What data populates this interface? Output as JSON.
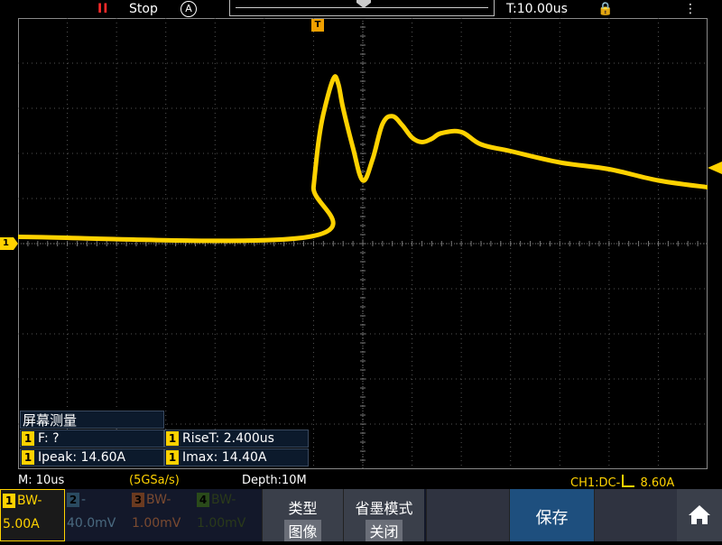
{
  "top_bar": {
    "run_icon": "II",
    "run_status": "Stop",
    "trigger_mode": "A",
    "trigger_delay": "T:10.00us",
    "lock_icon": "lock-icon",
    "usb_icon": "usb-icon"
  },
  "markers": {
    "trigger_flag": "T",
    "ch1_flag": "1"
  },
  "measurements": {
    "title": "屏幕测量",
    "items": [
      {
        "channel": "1",
        "text": "F:    ?"
      },
      {
        "channel": "1",
        "text": "RiseT: 2.400us"
      },
      {
        "channel": "1",
        "text": "Ipeak: 14.60A"
      },
      {
        "channel": "1",
        "text": "Imax: 14.40A"
      }
    ]
  },
  "info_bar": {
    "timebase": "M: 10us",
    "sample_rate": "(5GSa/s)",
    "depth": "Depth:10M",
    "channel_info_prefix": "CH1:DC-",
    "channel_info_value": "8.60A"
  },
  "channels": [
    {
      "num": "1",
      "line1": "BW-",
      "line2": "5.00A",
      "color": "#ffd200"
    },
    {
      "num": "2",
      "line1": "-",
      "line2": "40.0mV",
      "color": "#4a8ab0"
    },
    {
      "num": "3",
      "line1": "BW-",
      "line2": "1.00mV",
      "color": "#c0602a"
    },
    {
      "num": "4",
      "line1": "BW-",
      "line2": "1.00mV",
      "color": "#4a8a30"
    }
  ],
  "softkeys": {
    "type_label": "类型",
    "type_value": "图像",
    "ink_label": "省墨模式",
    "ink_value": "关闭",
    "save_label": "保存",
    "home_icon": "home-icon"
  },
  "colors": {
    "ch1": "#ffd200",
    "trigger": "#f0a000",
    "stop": "#ff2a2a"
  },
  "chart_data": {
    "type": "line",
    "title": "",
    "xlabel": "",
    "ylabel": "",
    "x_unit": "us",
    "y_unit": "A",
    "xlim": [
      -70,
      70
    ],
    "ylim": [
      -20,
      20
    ],
    "grid": true,
    "series": [
      {
        "x": [
          -70,
          -11,
          -10,
          -9,
          -8,
          -6,
          -5,
          -4,
          -2,
          0,
          2,
          4,
          6,
          8,
          10,
          12,
          14,
          16,
          20,
          24,
          30,
          40,
          50,
          60,
          70
        ],
        "values": [
          0.6,
          0.6,
          5.0,
          9.0,
          11.5,
          14.6,
          14.2,
          12.0,
          8.5,
          5.6,
          7.5,
          10.6,
          11.3,
          10.5,
          9.4,
          9.0,
          9.3,
          9.8,
          9.9,
          8.8,
          8.2,
          7.2,
          6.6,
          5.6,
          5.0
        ]
      }
    ]
  }
}
